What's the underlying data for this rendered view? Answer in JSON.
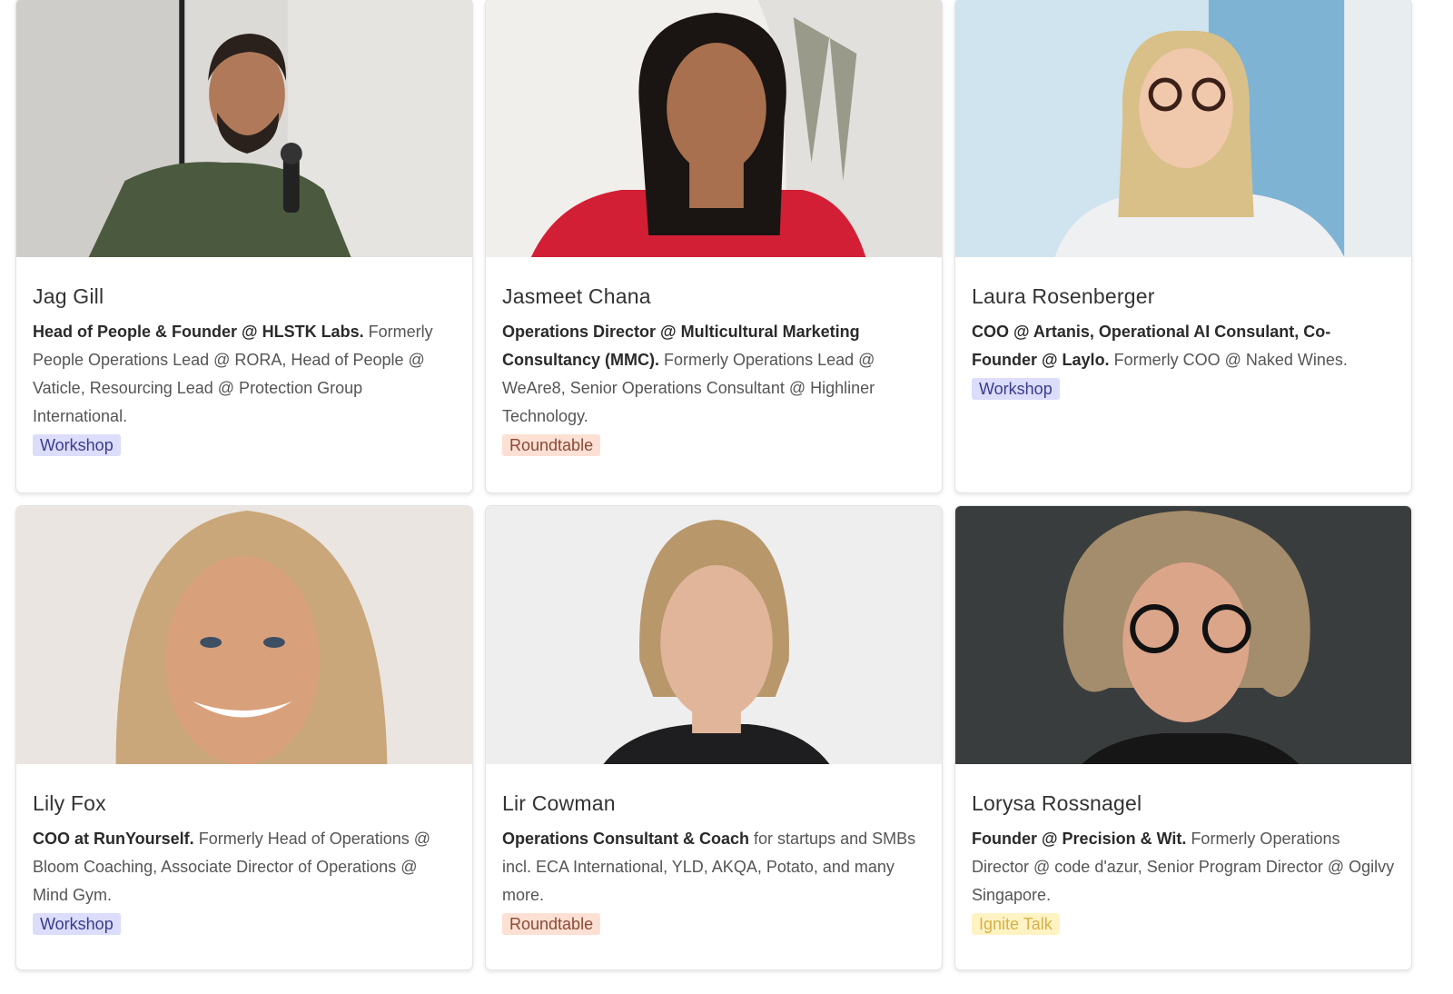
{
  "speakers": [
    {
      "name": "Jag Gill",
      "role": "Head of People & Founder @ HLSTK Labs.",
      "bio": "Formerly People Operations Lead @ RORA, Head of People @ Vaticle, Resourcing Lead @ Protection Group International.",
      "tag": "Workshop",
      "photo_icon": "speaker-photo"
    },
    {
      "name": "Jasmeet Chana",
      "role": "Operations Director @ Multicultural Marketing Consultancy (MMC).",
      "bio": "Formerly Operations Lead @ WeAre8, Senior Operations Consultant @ Highliner Technology.",
      "tag": "Roundtable",
      "photo_icon": "speaker-photo"
    },
    {
      "name": "Laura Rosenberger",
      "role": "COO @ Artanis, Operational AI Consulant, Co-Founder @ Laylo.",
      "bio": "Formerly COO @ Naked Wines.",
      "tag": "Workshop",
      "photo_icon": "speaker-photo"
    },
    {
      "name": "Lily Fox",
      "role": "COO at RunYourself.",
      "bio": "Formerly Head of Operations @ Bloom Coaching, Associate Director of Operations @ Mind Gym.",
      "tag": "Workshop",
      "photo_icon": "speaker-photo"
    },
    {
      "name": "Lir Cowman",
      "role": "Operations Consultant & Coach",
      "bio": "for startups and SMBs incl. ECA International, YLD, AKQA, Potato, and many more.",
      "tag": "Roundtable",
      "photo_icon": "speaker-photo"
    },
    {
      "name": "Lorysa Rossnagel",
      "role": "Founder @ Precision & Wit.",
      "bio": "Formerly Operations Director @ code d'azur, Senior Program Director @ Ogilvy Singapore.",
      "tag": "Ignite Talk",
      "photo_icon": "speaker-photo"
    }
  ],
  "colors": {
    "workshop_bg": "#dcdcfb",
    "roundtable_bg": "#fde0d4",
    "ignite_bg": "#fff3c4"
  }
}
